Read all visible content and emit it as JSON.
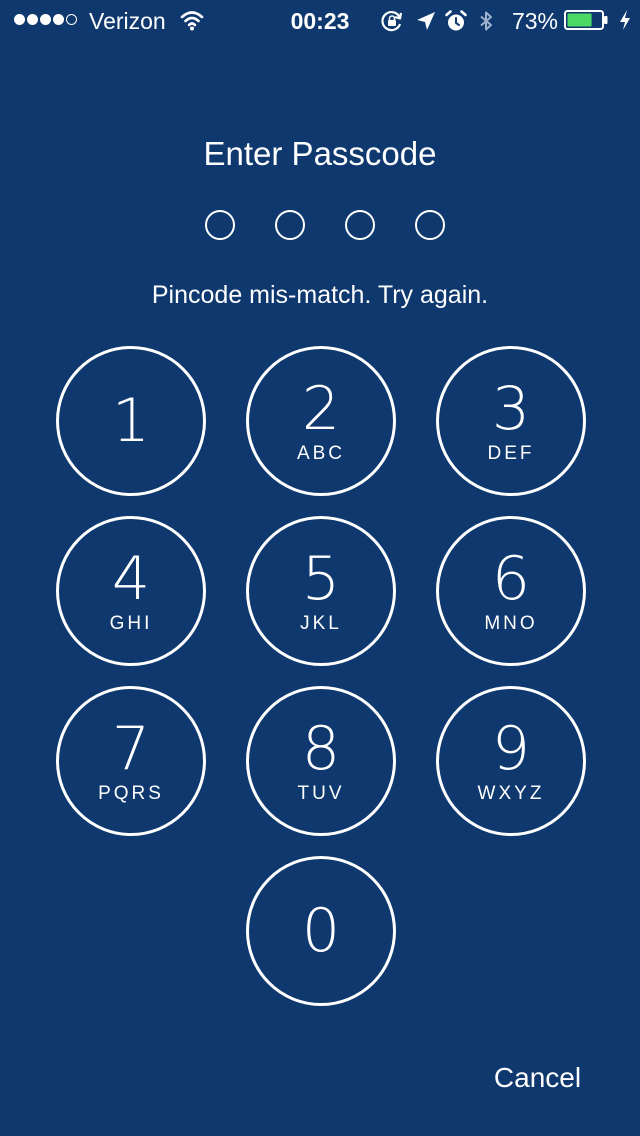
{
  "status_bar": {
    "carrier": "Verizon",
    "time": "00:23",
    "battery_percent": "73%",
    "battery_level": 0.73,
    "signal_bars_filled": 4,
    "signal_bars_total": 5,
    "icons": [
      "signal-dots-icon",
      "wifi-icon",
      "rotation-lock-icon",
      "location-arrow-icon",
      "alarm-clock-icon",
      "bluetooth-icon",
      "battery-icon",
      "charging-bolt-icon"
    ],
    "battery_color": "#4cd964"
  },
  "passcode": {
    "title": "Enter Passcode",
    "dots_total": 4,
    "dots_filled": 0,
    "message": "Pincode mis-match. Try again."
  },
  "keypad": {
    "keys": [
      {
        "digit": "1",
        "letters": ""
      },
      {
        "digit": "2",
        "letters": "ABC"
      },
      {
        "digit": "3",
        "letters": "DEF"
      },
      {
        "digit": "4",
        "letters": "GHI"
      },
      {
        "digit": "5",
        "letters": "JKL"
      },
      {
        "digit": "6",
        "letters": "MNO"
      },
      {
        "digit": "7",
        "letters": "PQRS"
      },
      {
        "digit": "8",
        "letters": "TUV"
      },
      {
        "digit": "9",
        "letters": "WXYZ"
      },
      {
        "digit": "0",
        "letters": ""
      }
    ],
    "cancel_label": "Cancel"
  },
  "colors": {
    "background": "#0e386e",
    "foreground": "#ffffff"
  }
}
